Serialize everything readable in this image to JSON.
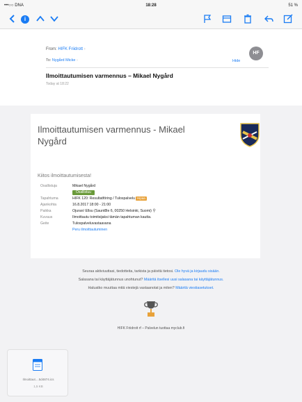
{
  "status_bar": {
    "carrier": "•••○○ DNA",
    "time": "18:28",
    "battery": "51 %"
  },
  "toolbar": {
    "icons": [
      "back-icon",
      "inbox-badge",
      "up-icon",
      "down-icon",
      "flag-icon",
      "folder-icon",
      "trash-icon",
      "reply-icon",
      "compose-icon"
    ],
    "accent": "#1a7cf4"
  },
  "email": {
    "from_label": "From:",
    "from_name": "HIFK Friidrott",
    "to_label": "To:",
    "to_name": "Nygård Micke",
    "hide_label": "Hide",
    "avatar_initials": "HF",
    "subject": "Ilmoittautumisen varmennus – Mikael Nygård",
    "date": "Today at 18:22"
  },
  "card": {
    "title": "Ilmoittautumisen varmennus - Mikael Nygård",
    "thanks": "Kiitos ilmoittautumisesta!",
    "rows": [
      {
        "label": "Osallistuja",
        "value": "Mikael Nygård"
      },
      {
        "label": "",
        "value": "Osallistuu",
        "pill": "green"
      },
      {
        "label": "Tapahtuma",
        "value": "HIFK 120: Resultatföring / Tulospalvelu",
        "tag": "Hipaa"
      },
      {
        "label": "Ajankohta",
        "value": "16.8.2017 18:00 - 21:00"
      },
      {
        "label": "Paikka",
        "value": "Ojuran/ Ellsu (Saunt8le 6, 00250 Helsinki, Suomi)"
      },
      {
        "label": "Kuvaus",
        "value": "Ilmoittautu toimitsijaksi tämän tapahtuman kautta."
      },
      {
        "label": "Geite",
        "value": "Tulospalveluvastaavana"
      },
      {
        "label": "",
        "value": "Peru ilmoittautuminen",
        "link": true
      }
    ]
  },
  "footer": {
    "line1_text": "Seuraa aktiviuuttasi, tiedotteita, tarkista ja päivitä tietosi.",
    "line1_link": "Ole hyvä ja kirjaudu sisään.",
    "line2_text": "Salasana tai käyttäjätunnus unohtunut?",
    "line2_link": "Määritä itsellesi uusi salasana tai käyttäjätunnus.",
    "line3_text": "Haluatko muuttaa mitä viestejä vastaanotat ja miten?",
    "line3_link": "Määritä viestiasetukset.",
    "org": "HIFK Friidrott rf – Palvelun tuottaa myclub.fi"
  },
  "attachment": {
    "name": "Ilmoittaut....5d4874.ics",
    "size": "1,5 KB"
  }
}
